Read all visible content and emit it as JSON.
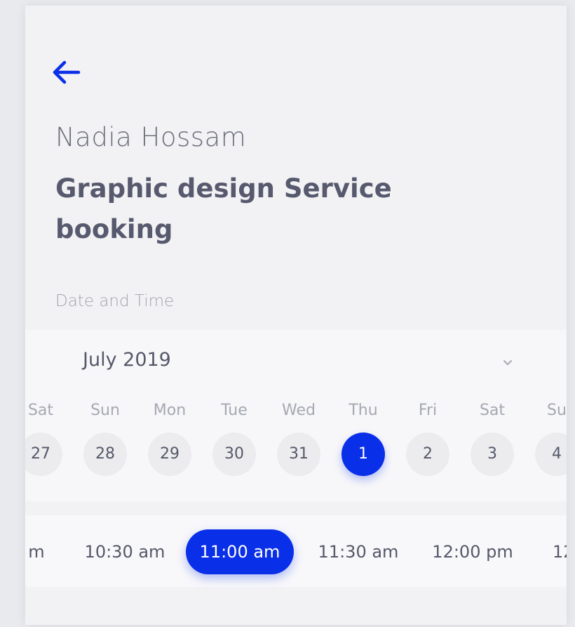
{
  "header": {
    "provider_name": "Nadia Hossam",
    "title": "Graphic design Service booking",
    "back_icon": "arrow-left-icon"
  },
  "date_time": {
    "label": "Date and Time",
    "month": "July 2019",
    "dropdown_icon": "chevron-down-icon",
    "days": [
      {
        "name": "Sat",
        "num": "27"
      },
      {
        "name": "Sun",
        "num": "28"
      },
      {
        "name": "Mon",
        "num": "29"
      },
      {
        "name": "Tue",
        "num": "30"
      },
      {
        "name": "Wed",
        "num": "31"
      },
      {
        "name": "Thu",
        "num": "1",
        "selected": true
      },
      {
        "name": "Fri",
        "num": "2"
      },
      {
        "name": "Sat",
        "num": "3"
      },
      {
        "name": "Su",
        "num": "4"
      }
    ]
  },
  "times": [
    {
      "label": "m"
    },
    {
      "label": "10:30 am"
    },
    {
      "label": "11:00 am",
      "selected": true
    },
    {
      "label": "11:30 am"
    },
    {
      "label": "12:00 pm"
    },
    {
      "label": "12"
    }
  ],
  "colors": {
    "accent": "#0a2fe8",
    "text": "#555869",
    "muted": "#a6a8b2",
    "background": "#f2f2f4"
  }
}
